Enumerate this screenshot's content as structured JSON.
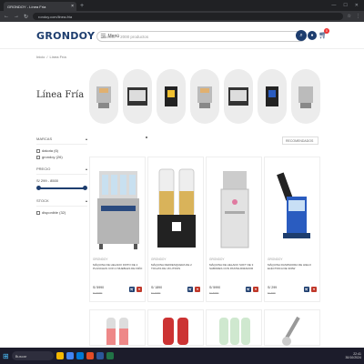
{
  "browser": {
    "tab_title": "GRONDOY - Línea Fría",
    "url": "rondoy.com/linea-fria"
  },
  "header": {
    "logo": "GRONDOY",
    "menu_label": "Menú",
    "search_placeholder": "Buscar + 2000 productos",
    "cart_count": "0"
  },
  "breadcrumb": {
    "home": "Inicio",
    "separator": "/",
    "current": "Línea Fría"
  },
  "page_title": "Línea Fría",
  "filters": {
    "brands_heading": "MARCAS",
    "brands": [
      {
        "label": "dakota (6)"
      },
      {
        "label": "grondoy (26)"
      }
    ],
    "price_heading": "PRECIO",
    "price_range": "S/ 299 - 8500",
    "price_min_fraction": 0,
    "price_max_fraction": 1,
    "stock_heading": "STOCK",
    "stock_option": "disponible (32)"
  },
  "sort": {
    "selected": "RECOMENDADOS"
  },
  "products": [
    {
      "brand": "GRONDOY",
      "name": "MÁQUINA DE HELADO FRITO DE 2 PLANCHAS CON 4 MUEBLES DE FRÍO",
      "price": "S/ 5990",
      "old_price": "S/ 6990",
      "image": "ice-cream-fry-machine"
    },
    {
      "brand": "GRONDOY",
      "name": "MÁQUINA REFRESQUERA DE 2 TOLVAS DE 18 LITROS",
      "price": "S/ 1890",
      "old_price": "S/ 2090",
      "image": "juice-dispenser"
    },
    {
      "brand": "GRONDOY",
      "name": "MÁQUINA DE HELADO SOFT DE 3 SABORES CON PASTEURIZADOR",
      "price": "S/ 5990",
      "old_price": "S/ 6990",
      "image": "soft-serve-machine"
    },
    {
      "brand": "GRONDOY",
      "name": "MÁQUINA RASPADORA DE HIELO ELÉCTRICA DE 300W",
      "price": "S/ 299",
      "old_price": "S/ 399",
      "image": "ice-shaver"
    }
  ],
  "taskbar": {
    "search_label": "Buscar",
    "time": "22:41",
    "date": "30/10/2024"
  }
}
